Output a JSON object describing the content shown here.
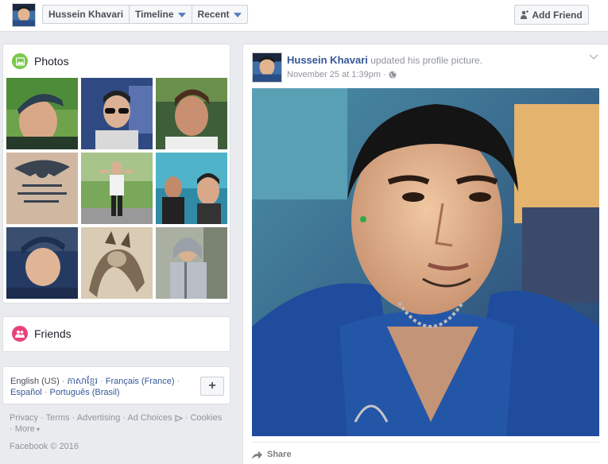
{
  "topbar": {
    "name": "Hussein Khavari",
    "timeline": "Timeline",
    "recent": "Recent",
    "add_friend": "Add Friend"
  },
  "photos": {
    "title": "Photos",
    "count": 9
  },
  "friends": {
    "title": "Friends"
  },
  "languages": {
    "current": "English (US)",
    "items": [
      "ភាសាខ្មែរ",
      "Français (France)",
      "Español",
      "Português (Brasil)"
    ],
    "plus": "+"
  },
  "footer": {
    "links": [
      "Privacy",
      "Terms",
      "Advertising",
      "Ad Choices",
      "Cookies",
      "More"
    ],
    "copyright": "Facebook © 2016"
  },
  "post": {
    "author": "Hussein Khavari",
    "action": "updated his profile picture.",
    "date": "November 25 at 1:39pm",
    "share": "Share"
  },
  "colors": {
    "link": "#365899",
    "photos_badge": "#7ac94a",
    "friends_badge": "#e8417b",
    "background": "#e9ebee"
  }
}
